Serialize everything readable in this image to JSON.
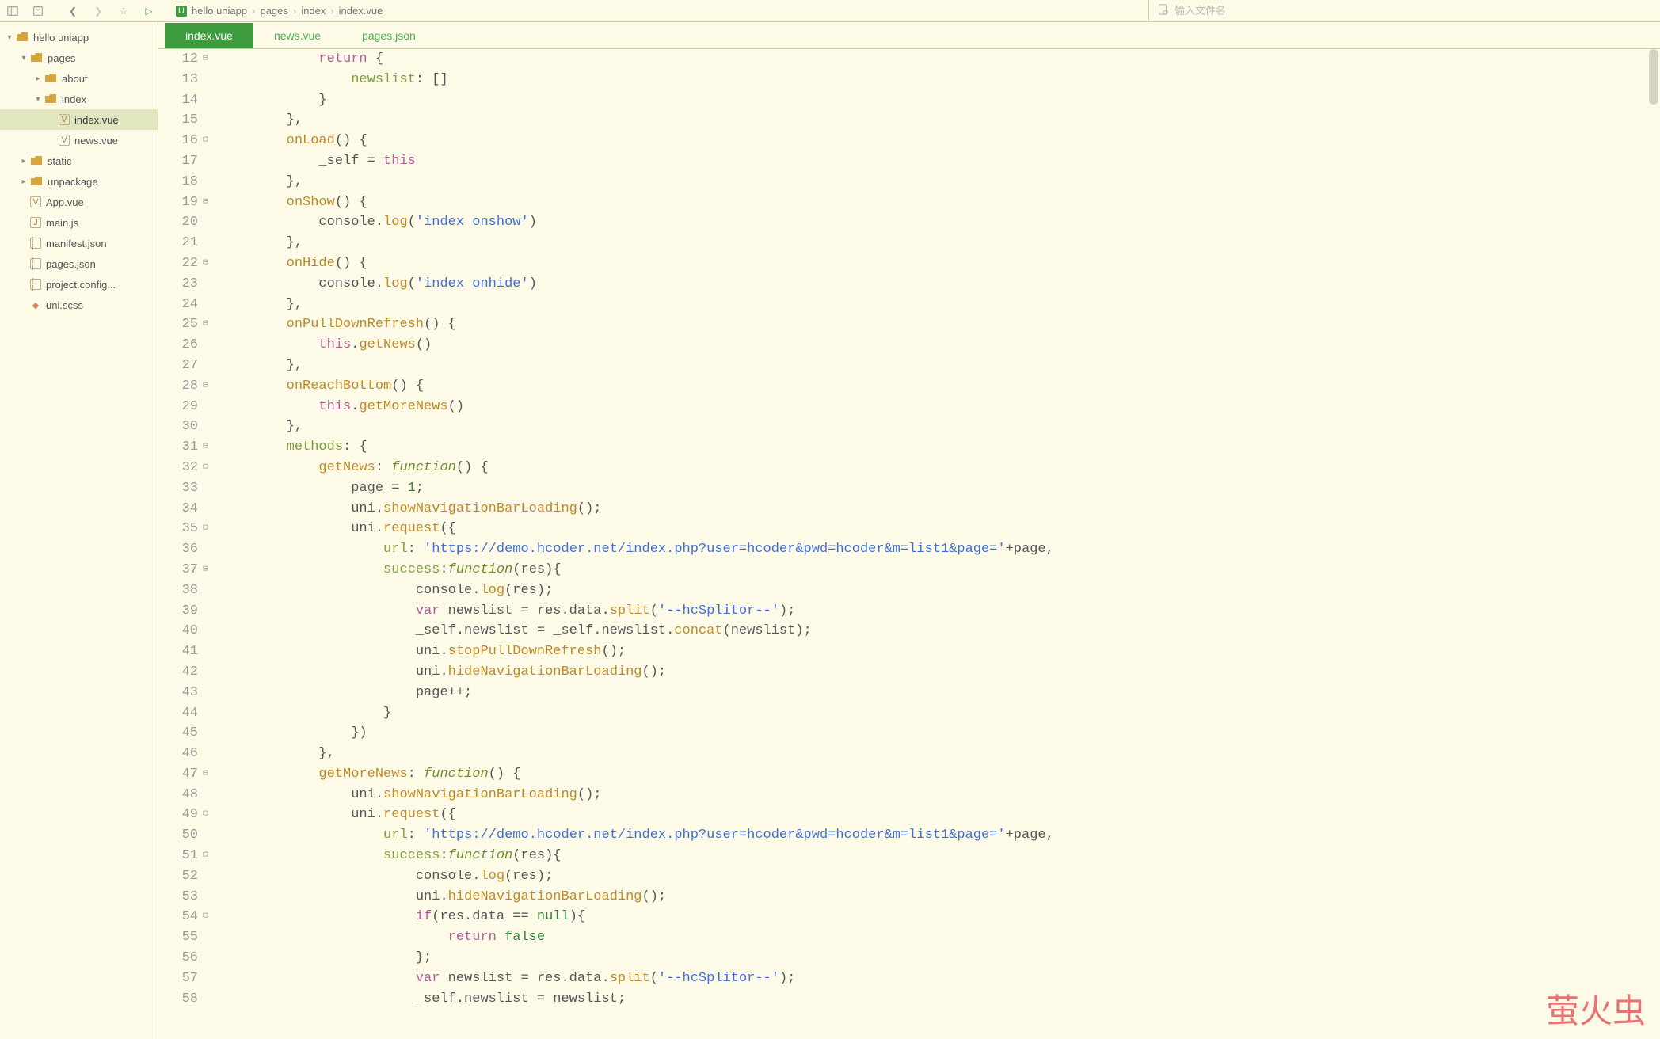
{
  "toolbar": {
    "filename_placeholder": "输入文件名"
  },
  "breadcrumb": [
    "hello uniapp",
    "pages",
    "index",
    "index.vue"
  ],
  "tree": [
    {
      "depth": 0,
      "caret": "▾",
      "icon": "folder",
      "label": "hello uniapp"
    },
    {
      "depth": 1,
      "caret": "▾",
      "icon": "folder",
      "label": "pages"
    },
    {
      "depth": 2,
      "caret": "▸",
      "icon": "folder",
      "label": "about"
    },
    {
      "depth": 2,
      "caret": "▾",
      "icon": "folder",
      "label": "index"
    },
    {
      "depth": 3,
      "caret": "",
      "icon": "V",
      "label": "index.vue",
      "active": true
    },
    {
      "depth": 3,
      "caret": "",
      "icon": "V",
      "label": "news.vue"
    },
    {
      "depth": 1,
      "caret": "▸",
      "icon": "folder",
      "label": "static"
    },
    {
      "depth": 1,
      "caret": "▸",
      "icon": "folder",
      "label": "unpackage"
    },
    {
      "depth": 1,
      "caret": "",
      "icon": "V",
      "label": "App.vue"
    },
    {
      "depth": 1,
      "caret": "",
      "icon": "J",
      "label": "main.js"
    },
    {
      "depth": 1,
      "caret": "",
      "icon": "[]",
      "label": "manifest.json"
    },
    {
      "depth": 1,
      "caret": "",
      "icon": "[]",
      "label": "pages.json"
    },
    {
      "depth": 1,
      "caret": "",
      "icon": "[]",
      "label": "project.config..."
    },
    {
      "depth": 1,
      "caret": "",
      "icon": "◆",
      "label": "uni.scss"
    }
  ],
  "tabs": [
    {
      "label": "index.vue",
      "active": true
    },
    {
      "label": "news.vue",
      "active": false
    },
    {
      "label": "pages.json",
      "active": false
    }
  ],
  "code": [
    {
      "n": 12,
      "f": "⊟",
      "indent": 3,
      "tokens": [
        {
          "t": "return",
          "c": "k"
        },
        {
          "t": " {",
          "c": "c"
        }
      ]
    },
    {
      "n": 13,
      "f": "",
      "indent": 4,
      "tokens": [
        {
          "t": "newslist",
          "c": "p"
        },
        {
          "t": ": []",
          "c": "c"
        }
      ]
    },
    {
      "n": 14,
      "f": "",
      "indent": 3,
      "tokens": [
        {
          "t": "}",
          "c": "c"
        }
      ]
    },
    {
      "n": 15,
      "f": "",
      "indent": 2,
      "tokens": [
        {
          "t": "},",
          "c": "c"
        }
      ]
    },
    {
      "n": 16,
      "f": "⊟",
      "indent": 2,
      "tokens": [
        {
          "t": "onLoad",
          "c": "m"
        },
        {
          "t": "() {",
          "c": "c"
        }
      ]
    },
    {
      "n": 17,
      "f": "",
      "indent": 3,
      "tokens": [
        {
          "t": "_self = ",
          "c": "c"
        },
        {
          "t": "this",
          "c": "k"
        }
      ]
    },
    {
      "n": 18,
      "f": "",
      "indent": 2,
      "tokens": [
        {
          "t": "},",
          "c": "c"
        }
      ]
    },
    {
      "n": 19,
      "f": "⊟",
      "indent": 2,
      "tokens": [
        {
          "t": "onShow",
          "c": "m"
        },
        {
          "t": "() {",
          "c": "c"
        }
      ]
    },
    {
      "n": 20,
      "f": "",
      "indent": 3,
      "tokens": [
        {
          "t": "console.",
          "c": "c"
        },
        {
          "t": "log",
          "c": "m"
        },
        {
          "t": "(",
          "c": "c"
        },
        {
          "t": "'index onshow'",
          "c": "s"
        },
        {
          "t": ")",
          "c": "c"
        }
      ]
    },
    {
      "n": 21,
      "f": "",
      "indent": 2,
      "tokens": [
        {
          "t": "},",
          "c": "c"
        }
      ]
    },
    {
      "n": 22,
      "f": "⊟",
      "indent": 2,
      "tokens": [
        {
          "t": "onHide",
          "c": "m"
        },
        {
          "t": "() {",
          "c": "c"
        }
      ]
    },
    {
      "n": 23,
      "f": "",
      "indent": 3,
      "tokens": [
        {
          "t": "console.",
          "c": "c"
        },
        {
          "t": "log",
          "c": "m"
        },
        {
          "t": "(",
          "c": "c"
        },
        {
          "t": "'index onhide'",
          "c": "s"
        },
        {
          "t": ")",
          "c": "c"
        }
      ]
    },
    {
      "n": 24,
      "f": "",
      "indent": 2,
      "tokens": [
        {
          "t": "},",
          "c": "c"
        }
      ]
    },
    {
      "n": 25,
      "f": "⊟",
      "indent": 2,
      "tokens": [
        {
          "t": "onPullDownRefresh",
          "c": "m"
        },
        {
          "t": "() {",
          "c": "c"
        }
      ]
    },
    {
      "n": 26,
      "f": "",
      "indent": 3,
      "tokens": [
        {
          "t": "this",
          "c": "k"
        },
        {
          "t": ".",
          "c": "c"
        },
        {
          "t": "getNews",
          "c": "m"
        },
        {
          "t": "()",
          "c": "c"
        }
      ]
    },
    {
      "n": 27,
      "f": "",
      "indent": 2,
      "tokens": [
        {
          "t": "},",
          "c": "c"
        }
      ]
    },
    {
      "n": 28,
      "f": "⊟",
      "indent": 2,
      "tokens": [
        {
          "t": "onReachBottom",
          "c": "m"
        },
        {
          "t": "() {",
          "c": "c"
        }
      ]
    },
    {
      "n": 29,
      "f": "",
      "indent": 3,
      "tokens": [
        {
          "t": "this",
          "c": "k"
        },
        {
          "t": ".",
          "c": "c"
        },
        {
          "t": "getMoreNews",
          "c": "m"
        },
        {
          "t": "()",
          "c": "c"
        }
      ]
    },
    {
      "n": 30,
      "f": "",
      "indent": 2,
      "tokens": [
        {
          "t": "},",
          "c": "c"
        }
      ]
    },
    {
      "n": 31,
      "f": "⊟",
      "indent": 2,
      "tokens": [
        {
          "t": "methods",
          "c": "p"
        },
        {
          "t": ": {",
          "c": "c"
        }
      ]
    },
    {
      "n": 32,
      "f": "⊟",
      "indent": 3,
      "tokens": [
        {
          "t": "getNews",
          "c": "m"
        },
        {
          "t": ": ",
          "c": "c"
        },
        {
          "t": "function",
          "c": "fn"
        },
        {
          "t": "() {",
          "c": "c"
        }
      ]
    },
    {
      "n": 33,
      "f": "",
      "indent": 4,
      "tokens": [
        {
          "t": "page = ",
          "c": "c"
        },
        {
          "t": "1",
          "c": "n"
        },
        {
          "t": ";",
          "c": "c"
        }
      ]
    },
    {
      "n": 34,
      "f": "",
      "indent": 4,
      "tokens": [
        {
          "t": "uni.",
          "c": "c"
        },
        {
          "t": "showNavigationBarLoading",
          "c": "m"
        },
        {
          "t": "();",
          "c": "c"
        }
      ]
    },
    {
      "n": 35,
      "f": "⊟",
      "indent": 4,
      "tokens": [
        {
          "t": "uni.",
          "c": "c"
        },
        {
          "t": "request",
          "c": "m"
        },
        {
          "t": "({",
          "c": "c"
        }
      ]
    },
    {
      "n": 36,
      "f": "",
      "indent": 5,
      "tokens": [
        {
          "t": "url",
          "c": "p"
        },
        {
          "t": ": ",
          "c": "c"
        },
        {
          "t": "'https://demo.hcoder.net/index.php?user=hcoder&pwd=hcoder&m=list1&page='",
          "c": "s"
        },
        {
          "t": "+page,",
          "c": "c"
        }
      ]
    },
    {
      "n": 37,
      "f": "⊟",
      "indent": 5,
      "tokens": [
        {
          "t": "success",
          "c": "p"
        },
        {
          "t": ":",
          "c": "c"
        },
        {
          "t": "function",
          "c": "fn"
        },
        {
          "t": "(res){",
          "c": "c"
        }
      ]
    },
    {
      "n": 38,
      "f": "",
      "indent": 6,
      "tokens": [
        {
          "t": "console.",
          "c": "c"
        },
        {
          "t": "log",
          "c": "m"
        },
        {
          "t": "(res);",
          "c": "c"
        }
      ]
    },
    {
      "n": 39,
      "f": "",
      "indent": 6,
      "tokens": [
        {
          "t": "var",
          "c": "k"
        },
        {
          "t": " newslist = res.data.",
          "c": "c"
        },
        {
          "t": "split",
          "c": "m"
        },
        {
          "t": "(",
          "c": "c"
        },
        {
          "t": "'--hcSplitor--'",
          "c": "s"
        },
        {
          "t": ");",
          "c": "c"
        }
      ]
    },
    {
      "n": 40,
      "f": "",
      "indent": 6,
      "tokens": [
        {
          "t": "_self.newslist = _self.newslist.",
          "c": "c"
        },
        {
          "t": "concat",
          "c": "m"
        },
        {
          "t": "(newslist);",
          "c": "c"
        }
      ]
    },
    {
      "n": 41,
      "f": "",
      "indent": 6,
      "tokens": [
        {
          "t": "uni.",
          "c": "c"
        },
        {
          "t": "stopPullDownRefresh",
          "c": "m"
        },
        {
          "t": "();",
          "c": "c"
        }
      ]
    },
    {
      "n": 42,
      "f": "",
      "indent": 6,
      "tokens": [
        {
          "t": "uni.",
          "c": "c"
        },
        {
          "t": "hideNavigationBarLoading",
          "c": "m"
        },
        {
          "t": "();",
          "c": "c"
        }
      ]
    },
    {
      "n": 43,
      "f": "",
      "indent": 6,
      "tokens": [
        {
          "t": "page++;",
          "c": "c"
        }
      ]
    },
    {
      "n": 44,
      "f": "",
      "indent": 5,
      "tokens": [
        {
          "t": "}",
          "c": "c"
        }
      ]
    },
    {
      "n": 45,
      "f": "",
      "indent": 4,
      "tokens": [
        {
          "t": "})",
          "c": "c"
        }
      ]
    },
    {
      "n": 46,
      "f": "",
      "indent": 3,
      "tokens": [
        {
          "t": "},",
          "c": "c"
        }
      ]
    },
    {
      "n": 47,
      "f": "⊟",
      "indent": 3,
      "tokens": [
        {
          "t": "getMoreNews",
          "c": "m"
        },
        {
          "t": ": ",
          "c": "c"
        },
        {
          "t": "function",
          "c": "fn"
        },
        {
          "t": "() {",
          "c": "c"
        }
      ]
    },
    {
      "n": 48,
      "f": "",
      "indent": 4,
      "tokens": [
        {
          "t": "uni.",
          "c": "c"
        },
        {
          "t": "showNavigationBarLoading",
          "c": "m"
        },
        {
          "t": "();",
          "c": "c"
        }
      ]
    },
    {
      "n": 49,
      "f": "⊟",
      "indent": 4,
      "tokens": [
        {
          "t": "uni.",
          "c": "c"
        },
        {
          "t": "request",
          "c": "m"
        },
        {
          "t": "({",
          "c": "c"
        }
      ]
    },
    {
      "n": 50,
      "f": "",
      "indent": 5,
      "tokens": [
        {
          "t": "url",
          "c": "p"
        },
        {
          "t": ": ",
          "c": "c"
        },
        {
          "t": "'https://demo.hcoder.net/index.php?user=hcoder&pwd=hcoder&m=list1&page='",
          "c": "s"
        },
        {
          "t": "+page,",
          "c": "c"
        }
      ]
    },
    {
      "n": 51,
      "f": "⊟",
      "indent": 5,
      "tokens": [
        {
          "t": "success",
          "c": "p"
        },
        {
          "t": ":",
          "c": "c"
        },
        {
          "t": "function",
          "c": "fn"
        },
        {
          "t": "(res){",
          "c": "c"
        }
      ]
    },
    {
      "n": 52,
      "f": "",
      "indent": 6,
      "tokens": [
        {
          "t": "console.",
          "c": "c"
        },
        {
          "t": "log",
          "c": "m"
        },
        {
          "t": "(res);",
          "c": "c"
        }
      ]
    },
    {
      "n": 53,
      "f": "",
      "indent": 6,
      "tokens": [
        {
          "t": "uni.",
          "c": "c"
        },
        {
          "t": "hideNavigationBarLoading",
          "c": "m"
        },
        {
          "t": "();",
          "c": "c"
        }
      ]
    },
    {
      "n": 54,
      "f": "⊟",
      "indent": 6,
      "tokens": [
        {
          "t": "if",
          "c": "k"
        },
        {
          "t": "(res.data == ",
          "c": "c"
        },
        {
          "t": "null",
          "c": "n"
        },
        {
          "t": "){",
          "c": "c"
        }
      ]
    },
    {
      "n": 55,
      "f": "",
      "indent": 7,
      "tokens": [
        {
          "t": "return",
          "c": "k"
        },
        {
          "t": " ",
          "c": "c"
        },
        {
          "t": "false",
          "c": "n"
        }
      ]
    },
    {
      "n": 56,
      "f": "",
      "indent": 6,
      "tokens": [
        {
          "t": "};",
          "c": "c"
        }
      ]
    },
    {
      "n": 57,
      "f": "",
      "indent": 6,
      "tokens": [
        {
          "t": "var",
          "c": "k"
        },
        {
          "t": " newslist = res.data.",
          "c": "c"
        },
        {
          "t": "split",
          "c": "m"
        },
        {
          "t": "(",
          "c": "c"
        },
        {
          "t": "'--hcSplitor--'",
          "c": "s"
        },
        {
          "t": ");",
          "c": "c"
        }
      ]
    },
    {
      "n": 58,
      "f": "",
      "indent": 6,
      "tokens": [
        {
          "t": "_self.newslist = newslist;",
          "c": "c"
        }
      ]
    }
  ],
  "watermark": "萤火虫"
}
